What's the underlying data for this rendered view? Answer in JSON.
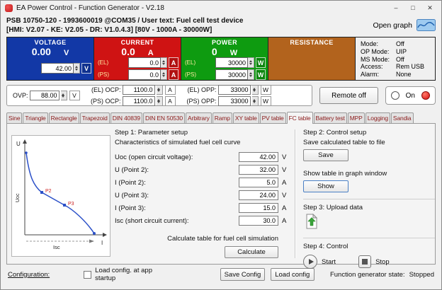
{
  "window": {
    "title": "EA Power Control - Function Generator - V2.18",
    "minimize": "–",
    "maximize": "□",
    "close": "✕"
  },
  "header": {
    "line1": "PSB 10750-120 - 1993600019 @COM35 / User text: Fuel cell test device",
    "line2": "[HMI: V2.07 - KE: V2.05 - DR: V1.0.4.3] [80V - 1000A - 30000W]",
    "open_graph_label": "Open graph"
  },
  "meters": {
    "voltage": {
      "title": "VOLTAGE",
      "value": "0.00",
      "unit": "V",
      "set_value": "42.00",
      "set_unit": "V"
    },
    "current": {
      "title": "CURRENT",
      "value": "0.0",
      "unit": "A",
      "rows": [
        {
          "label": "(EL)",
          "value": "0.0",
          "unit": "A"
        },
        {
          "label": "(PS)",
          "value": "0.0",
          "unit": "A"
        }
      ]
    },
    "power": {
      "title": "POWER",
      "value": "0",
      "unit": "W",
      "rows": [
        {
          "label": "(EL)",
          "value": "30000",
          "unit": "W"
        },
        {
          "label": "(PS)",
          "value": "30000",
          "unit": "W"
        }
      ]
    },
    "resistance": {
      "title": "RESISTANCE"
    }
  },
  "status": {
    "rows": [
      {
        "label": "Mode:",
        "value": "Off"
      },
      {
        "label": "OP Mode:",
        "value": "UIP"
      },
      {
        "label": "MS Mode:",
        "value": "Off"
      },
      {
        "label": "Access:",
        "value": "Rem USB"
      },
      {
        "label": "Alarm:",
        "value": "None"
      }
    ]
  },
  "protection": {
    "ovp": {
      "label": "OVP:",
      "value": "88.00",
      "unit": "V"
    },
    "el_ocp": {
      "label": "(EL) OCP:",
      "value": "1100.0",
      "unit": "A"
    },
    "ps_ocp": {
      "label": "(PS) OCP:",
      "value": "1100.0",
      "unit": "A"
    },
    "el_opp": {
      "label": "(EL) OPP:",
      "value": "33000",
      "unit": "W"
    },
    "ps_opp": {
      "label": "(PS) OPP:",
      "value": "33000",
      "unit": "W"
    },
    "remote_button": "Remote off",
    "on_label": "On"
  },
  "tabs": [
    "Sine",
    "Triangle",
    "Rectangle",
    "Trapezoid",
    "DIN 40839",
    "DIN EN 50530",
    "Arbitrary",
    "Ramp",
    "XY table",
    "PV table",
    "FC table",
    "Battery test",
    "MPP",
    "Logging",
    "Sandia"
  ],
  "active_tab": "FC table",
  "fc_table": {
    "graph": {
      "y_axis": "U",
      "x_axis": "I",
      "y_label": "Uoc",
      "x_label": "Isc",
      "p2": "P2",
      "p3": "P3"
    },
    "step1": {
      "title": "Step 1: Parameter setup",
      "subtitle": "Characteristics of simulated fuel cell curve",
      "params": [
        {
          "label": "Uoc (open circuit voltage):",
          "value": "42.00",
          "unit": "V"
        },
        {
          "label": "U (Point 2):",
          "value": "32.00",
          "unit": "V"
        },
        {
          "label": "I (Point 2):",
          "value": "5.0",
          "unit": "A"
        },
        {
          "label": "U (Point 3):",
          "value": "24.00",
          "unit": "V"
        },
        {
          "label": "I (Point 3):",
          "value": "15.0",
          "unit": "A"
        },
        {
          "label": "Isc (short circuit current):",
          "value": "30.0",
          "unit": "A"
        }
      ],
      "calculate_label": "Calculate table for fuel cell simulation",
      "calculate_button": "Calculate"
    },
    "step2": {
      "title": "Step 2: Control setup",
      "save_label": "Save calculated table to file",
      "save_button": "Save",
      "show_label": "Show table in graph window",
      "show_button": "Show"
    },
    "step3": {
      "title": "Step 3: Upload data"
    },
    "step4": {
      "title": "Step 4: Control",
      "start_button": "Start",
      "stop_button": "Stop"
    }
  },
  "footer": {
    "configuration_link": "Configuration:",
    "startup_checkbox_label": "Load config. at app startup",
    "save_config_button": "Save Config",
    "load_config_button": "Load config",
    "state_label": "Function generator state:",
    "state_value": "Stopped"
  },
  "colors": {
    "voltage_blue": "#1238a6",
    "current_red": "#cf1313",
    "power_green": "#0e9b10",
    "resistance_brown": "#b2631d",
    "tab_text_maroon": "#8b1a1a",
    "led_red": "#d90f0f"
  }
}
